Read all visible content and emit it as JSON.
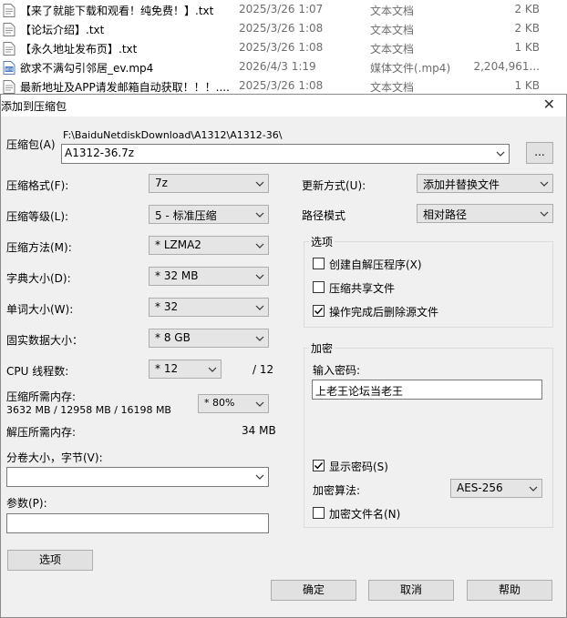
{
  "files": [
    {
      "name": "【来了就能下载和观看！纯免费！】.txt",
      "date": "2025/3/26 1:07",
      "type": "文本文档",
      "size": "2 KB",
      "icon": "txt-file-icon"
    },
    {
      "name": "【论坛介绍】.txt",
      "date": "2025/3/26 1:08",
      "type": "文本文档",
      "size": "2 KB",
      "icon": "txt-file-icon"
    },
    {
      "name": "【永久地址发布页】.txt",
      "date": "2025/3/26 1:08",
      "type": "文本文档",
      "size": "1 KB",
      "icon": "txt-file-icon"
    },
    {
      "name": "欲求不满勾引邻居_ev.mp4",
      "date": "2026/4/3 1:19",
      "type": "媒体文件(.mp4)",
      "size": "2,204,961...",
      "icon": "video-file-icon"
    },
    {
      "name": "最新地址及APP请发邮箱自动获取！！！....",
      "date": "2025/3/26 1:08",
      "type": "文本文档",
      "size": "1 KB",
      "icon": "txt-file-icon"
    }
  ],
  "dialog": {
    "title": "添加到压缩包",
    "archive_label": "压缩包(A)",
    "archive_path": "F:\\BaiduNetdiskDownload\\A1312\\A1312-36\\",
    "archive_name": "A1312-36.7z",
    "browse_label": "...",
    "format_label": "压缩格式(F):",
    "format_value": "7z",
    "level_label": "压缩等级(L):",
    "level_value": "5 - 标准压缩",
    "method_label": "压缩方法(M):",
    "method_value": "* LZMA2",
    "dict_label": "字典大小(D):",
    "dict_value": "* 32 MB",
    "word_label": "单词大小(W):",
    "word_value": "* 32",
    "solid_label": "固实数据大小：",
    "solid_value": "* 8 GB",
    "cpu_label": "CPU 线程数:",
    "cpu_value": "* 12",
    "cpu_total": "/ 12",
    "mem_comp_label": "压缩所需内存:",
    "mem_comp_values": "3632 MB / 12958 MB / 16198 MB",
    "mem_percent": "* 80%",
    "mem_decomp_label": "解压所需内存:",
    "mem_decomp_value": "34 MB",
    "split_label": "分卷大小，字节(V):",
    "split_value": "",
    "params_label": "参数(P):",
    "params_value": "",
    "options_button": "选项",
    "update_label": "更新方式(U):",
    "update_value": "添加并替换文件",
    "path_label": "路径模式",
    "path_value": "相对路径",
    "options_group": "选项",
    "opt_sfx": "创建自解压程序(X)",
    "opt_sfx_checked": false,
    "opt_shared": "压缩共享文件",
    "opt_shared_checked": false,
    "opt_delete": "操作完成后删除源文件",
    "opt_delete_checked": true,
    "encrypt_group": "加密",
    "password_label": "输入密码:",
    "password_value": "上老王论坛当老王",
    "show_password": "显示密码(S)",
    "show_password_checked": true,
    "enc_method_label": "加密算法:",
    "enc_method_value": "AES-256",
    "encrypt_names": "加密文件名(N)",
    "encrypt_names_checked": false,
    "ok_button": "确定",
    "cancel_button": "取消",
    "help_button": "帮助"
  }
}
